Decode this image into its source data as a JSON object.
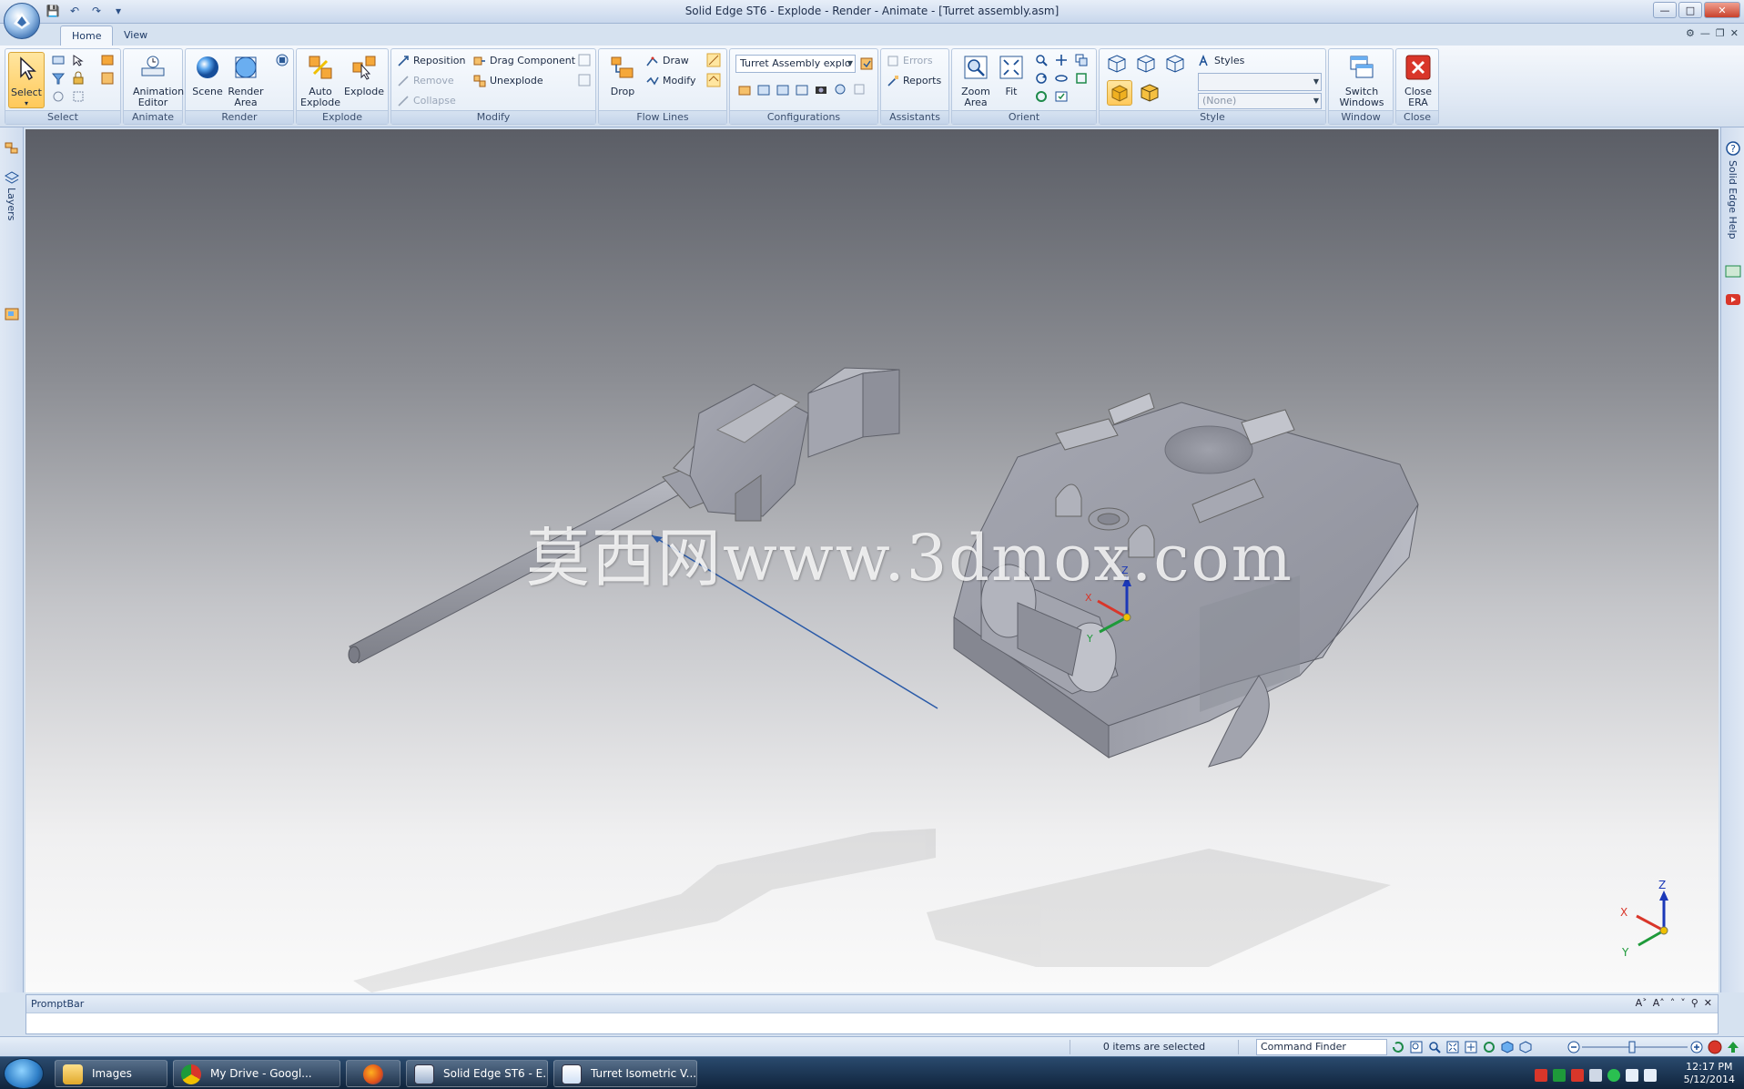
{
  "window": {
    "title": "Solid Edge ST6 - Explode - Render - Animate - [Turret assembly.asm]"
  },
  "tabs": [
    {
      "label": "Home",
      "active": true
    },
    {
      "label": "View",
      "active": false
    }
  ],
  "ribbon": {
    "groups": {
      "select": "Select",
      "animate": "Animate",
      "render": "Render",
      "explode": "Explode",
      "modify": "Modify",
      "flow_lines": "Flow Lines",
      "configurations": "Configurations",
      "assistants": "Assistants",
      "orient": "Orient",
      "style": "Style",
      "window": "Window",
      "close": "Close"
    },
    "buttons": {
      "select": "Select",
      "animation_editor_1": "Animation",
      "animation_editor_2": "Editor",
      "scene": "Scene",
      "render_area_1": "Render",
      "render_area_2": "Area",
      "auto_explode_1": "Auto",
      "auto_explode_2": "Explode",
      "explode": "Explode",
      "reposition": "Reposition",
      "remove": "Remove",
      "collapse": "Collapse",
      "drag_component": "Drag Component",
      "unexplode": "Unexplode",
      "drop": "Drop",
      "draw": "Draw",
      "modify": "Modify",
      "errors": "Errors",
      "reports": "Reports",
      "zoom_area_1": "Zoom",
      "zoom_area_2": "Area",
      "fit": "Fit",
      "styles": "Styles",
      "switch_windows_1": "Switch",
      "switch_windows_2": "Windows",
      "close_era_1": "Close",
      "close_era_2": "ERA"
    },
    "configuration_combo": "Turret Assembly explo",
    "style_combo_top": "",
    "style_combo_bottom": "(None)"
  },
  "side_panels": {
    "left_tab": "Layers",
    "right_tab": "Solid Edge Help"
  },
  "viewport": {
    "watermark": "莫西网www.3dmox.com",
    "triad_labels": {
      "x": "X",
      "y": "Y",
      "z": "Z"
    }
  },
  "promptbar": {
    "title": "PromptBar"
  },
  "statusbar": {
    "selection_text": "0 items are selected",
    "command_finder": "Command Finder"
  },
  "taskbar": {
    "tasks": [
      {
        "label": "Images"
      },
      {
        "label": "My Drive - Googl..."
      },
      {
        "label": ""
      },
      {
        "label": "Solid Edge ST6 - E..."
      },
      {
        "label": "Turret Isometric V..."
      }
    ],
    "clock_time": "12:17 PM",
    "clock_date": "5/12/2014"
  },
  "colors": {
    "ribbon_bg": "#dfe8f4",
    "viewport_top": "#5b5e66",
    "viewport_bottom": "#fafafa",
    "model_gray": "#9a9ca6",
    "selected_button": "#ffc95a",
    "close_red": "#d9362a"
  }
}
